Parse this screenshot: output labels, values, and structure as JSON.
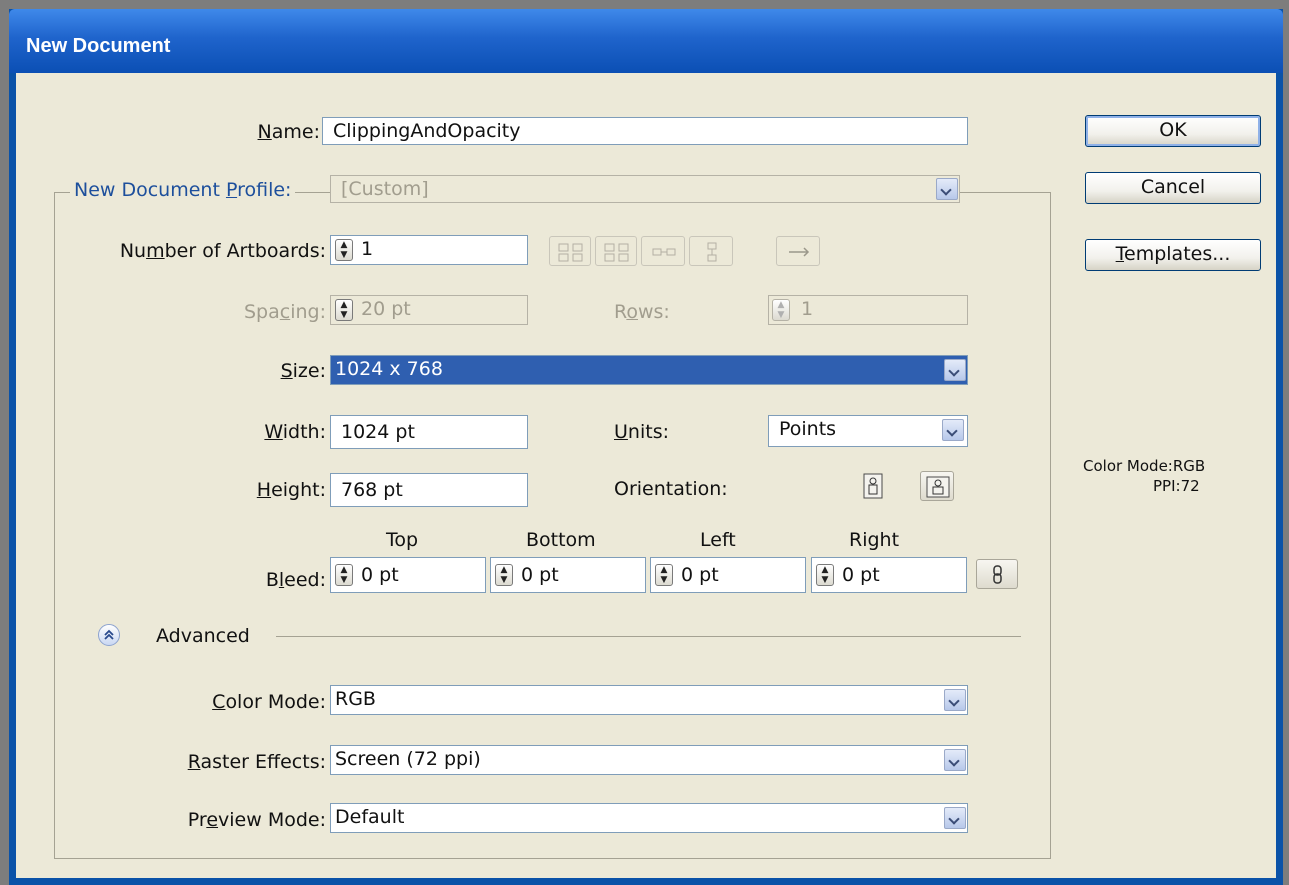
{
  "window": {
    "title": "New Document"
  },
  "form": {
    "name": {
      "label": "Name:",
      "value": "ClippingAndOpacity"
    },
    "profile": {
      "label": "New Document Profile:",
      "value": "[Custom]"
    },
    "artboards": {
      "label": "Number of Artboards:",
      "value": "1"
    },
    "spacing": {
      "label": "Spacing:",
      "value": "20 pt"
    },
    "rows": {
      "label": "Rows:",
      "value": "1"
    },
    "size": {
      "label": "Size:",
      "value": "1024 x 768"
    },
    "width": {
      "label": "Width:",
      "value": "1024 pt"
    },
    "units": {
      "label": "Units:",
      "value": "Points"
    },
    "height": {
      "label": "Height:",
      "value": "768 pt"
    },
    "orientation": {
      "label": "Orientation:"
    },
    "bleed": {
      "label": "Bleed:",
      "top": {
        "label": "Top",
        "value": "0 pt"
      },
      "bottom": {
        "label": "Bottom",
        "value": "0 pt"
      },
      "left": {
        "label": "Left",
        "value": "0 pt"
      },
      "right": {
        "label": "Right",
        "value": "0 pt"
      }
    },
    "advanced": {
      "label": "Advanced"
    },
    "color_mode": {
      "label": "Color Mode:",
      "value": "RGB"
    },
    "raster_effects": {
      "label": "Raster Effects:",
      "value": "Screen (72 ppi)"
    },
    "preview_mode": {
      "label": "Preview Mode:",
      "value": "Default"
    }
  },
  "buttons": {
    "ok": "OK",
    "cancel": "Cancel",
    "templates": "Templates..."
  },
  "info": {
    "color_mode": "Color Mode:RGB",
    "ppi": "PPI:72"
  },
  "icons": {
    "artboard_layout": [
      "grid-by-row-icon",
      "grid-by-column-icon",
      "arrange-by-row-icon",
      "arrange-by-column-icon"
    ],
    "direction": "left-to-right-arrow-icon",
    "orientation": [
      "portrait-icon",
      "landscape-icon"
    ],
    "link": "link-icon",
    "advanced_toggle": "chevron-up-icon"
  }
}
